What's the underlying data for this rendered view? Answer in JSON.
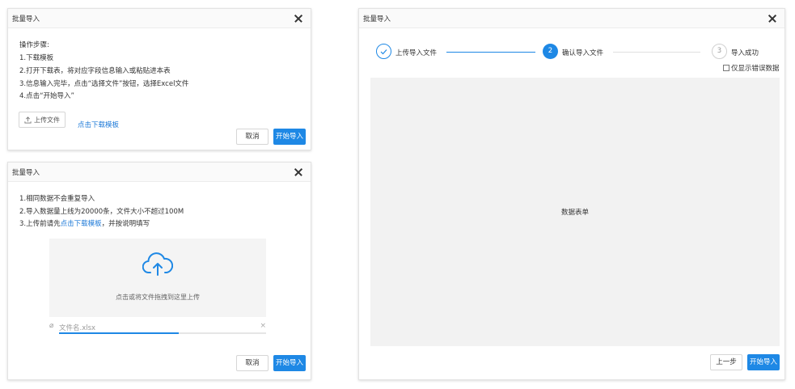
{
  "dialog1": {
    "title": "批量导入",
    "steps_heading": "操作步骤:",
    "steps": [
      "1.下载模板",
      "2.打开下载表，将对应字段信息输入或粘贴进本表",
      "3.信息输入完毕，点击“选择文件”按钮，选择Excel文件",
      "4.点击“开始导入”"
    ],
    "upload_label": "上传文件",
    "download_link": "点击下载模板",
    "cancel_label": "取消",
    "start_label": "开始导入"
  },
  "dialog2": {
    "title": "批量导入",
    "line1": "1.相同数据不会重复导入",
    "line2": "2.导入数据量上线为20000条，文件大小不超过100M",
    "line3_prefix": "3.上传前请先",
    "line3_link": "点击下载模板",
    "line3_suffix": "，并按说明填写",
    "dropzone_text": "点击或将文件拖拽到这里上传",
    "file_name": "文件名.xlsx",
    "upload_progress": 0.58,
    "cancel_label": "取消",
    "start_label": "开始导入"
  },
  "dialog3": {
    "title": "批量导入",
    "steps": [
      {
        "label": "上传导入文件",
        "state": "done"
      },
      {
        "number": "2",
        "label": "确认导入文件",
        "state": "active"
      },
      {
        "number": "3",
        "label": "导入成功",
        "state": "pending"
      }
    ],
    "errors_only_label": "仅显示错误数据",
    "errors_only_checked": false,
    "table_placeholder": "数据表单",
    "prev_label": "上一步",
    "start_label": "开始导入"
  },
  "colors": {
    "primary": "#1e88e5",
    "link": "#1e7ad8",
    "panel_bg": "#f2f2f2"
  }
}
